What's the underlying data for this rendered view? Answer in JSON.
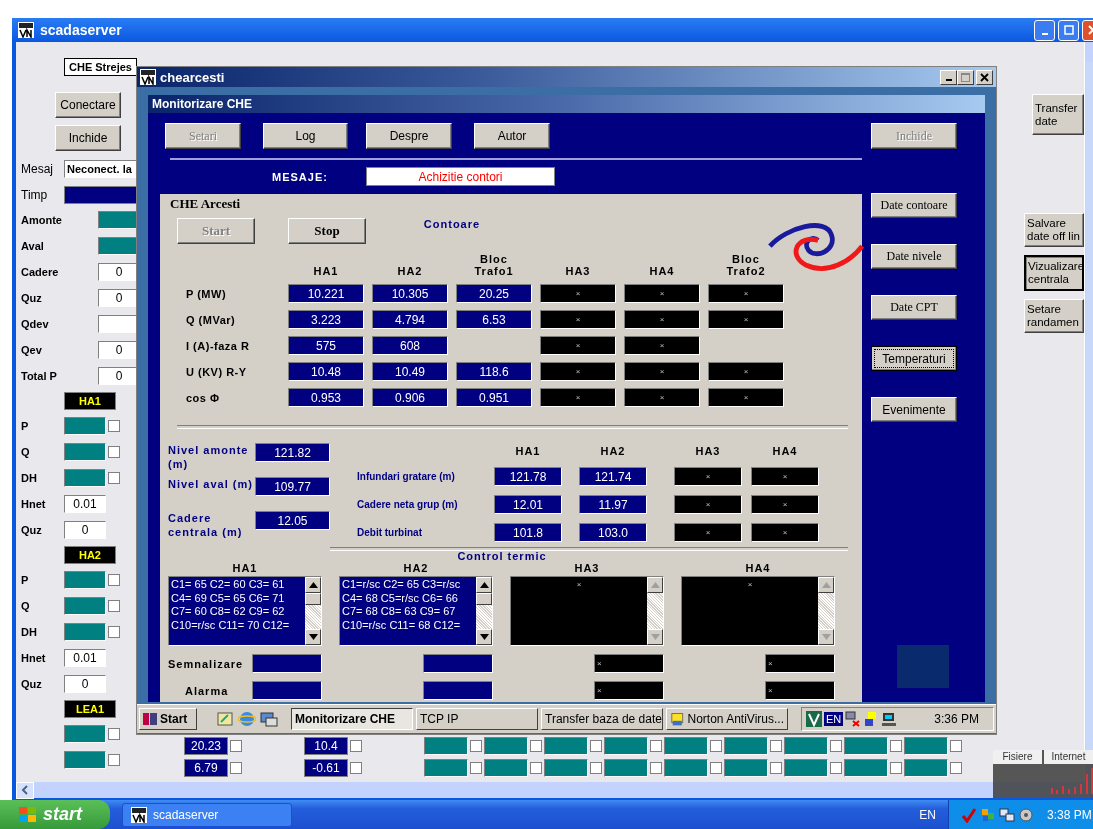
{
  "window": {
    "title": "scadaserver"
  },
  "station_selector": {
    "value": "CHE Strejes"
  },
  "left_panel": {
    "buttons": [
      "Conectare",
      "Inchide"
    ],
    "mesaj": {
      "label": "Mesaj",
      "value": "Neconect. la"
    },
    "timp": {
      "label": "Timp"
    },
    "params": [
      {
        "label": "Amonte",
        "kind": "indicator"
      },
      {
        "label": "Aval",
        "kind": "indicator"
      },
      {
        "label": "Cadere",
        "kind": "field",
        "value": "0"
      },
      {
        "label": "Quz",
        "kind": "field",
        "value": "0"
      },
      {
        "label": "Qdev",
        "kind": "field"
      },
      {
        "label": "Qev",
        "kind": "field",
        "value": "0"
      },
      {
        "label": "Total P",
        "kind": "field",
        "value": "0"
      }
    ],
    "groups": [
      {
        "tag": "HA1",
        "rows": [
          {
            "label": "P",
            "kind": "indicator",
            "checked": false
          },
          {
            "label": "Q",
            "kind": "indicator",
            "checked": false
          },
          {
            "label": "DH",
            "kind": "indicator",
            "checked": false
          },
          {
            "label": "Hnet",
            "kind": "field",
            "value": "0.01"
          },
          {
            "label": "Quz",
            "kind": "field",
            "value": "0"
          }
        ]
      },
      {
        "tag": "HA2",
        "rows": [
          {
            "label": "P",
            "kind": "indicator",
            "checked": false
          },
          {
            "label": "Q",
            "kind": "indicator",
            "checked": false
          },
          {
            "label": "DH",
            "kind": "indicator",
            "checked": false
          },
          {
            "label": "Hnet",
            "kind": "field",
            "value": "0.01"
          },
          {
            "label": "Quz",
            "kind": "field",
            "value": "0"
          }
        ]
      },
      {
        "tag": "LEA1",
        "rows": [
          {
            "kind": "indicator",
            "checked": false
          },
          {
            "kind": "indicator",
            "checked": false
          }
        ]
      }
    ]
  },
  "right_buttons": [
    {
      "label": "Transfer date",
      "pressed": false
    },
    {
      "label": "Salvare date off lin",
      "pressed": false
    },
    {
      "label": "Vizualizare centrala",
      "pressed": true
    },
    {
      "label": "Setare randamen",
      "pressed": false
    }
  ],
  "bottom_rows": [
    {
      "cells": [
        {
          "kind": "value",
          "value": "20.23",
          "checked": false
        },
        {
          "kind": "value",
          "value": "10.4",
          "checked": false
        },
        {
          "kind": "indicator",
          "checked": false
        },
        {
          "kind": "indicator",
          "checked": false
        },
        {
          "kind": "indicator",
          "checked": false
        },
        {
          "kind": "indicator",
          "checked": false
        },
        {
          "kind": "indicator",
          "checked": false
        },
        {
          "kind": "indicator",
          "checked": false
        },
        {
          "kind": "indicator",
          "checked": false
        },
        {
          "kind": "indicator",
          "checked": false
        },
        {
          "kind": "indicator",
          "checked": false
        }
      ]
    },
    {
      "cells": [
        {
          "kind": "value",
          "value": "6.79",
          "checked": false
        },
        {
          "kind": "value",
          "value": "-0.61",
          "checked": false
        },
        {
          "kind": "indicator",
          "checked": false
        },
        {
          "kind": "indicator",
          "checked": false
        },
        {
          "kind": "indicator",
          "checked": false
        },
        {
          "kind": "indicator",
          "checked": false
        },
        {
          "kind": "indicator",
          "checked": false
        },
        {
          "kind": "indicator",
          "checked": false
        },
        {
          "kind": "indicator",
          "checked": false
        },
        {
          "kind": "indicator",
          "checked": false
        },
        {
          "kind": "indicator",
          "checked": false
        }
      ]
    }
  ],
  "dialog": {
    "title": "chearcesti",
    "frame_title": "Monitorizare CHE",
    "toolbar": [
      {
        "label": "Setari",
        "disabled": true
      },
      {
        "label": "Log",
        "disabled": false
      },
      {
        "label": "Despre",
        "disabled": false
      },
      {
        "label": "Autor",
        "disabled": false
      }
    ],
    "close_button": {
      "label": "Inchide",
      "disabled": true
    },
    "messages": {
      "label": "MESAJE:",
      "value": "Achizitie contori"
    },
    "side_buttons": [
      {
        "label": "Date contoare",
        "focused": false
      },
      {
        "label": "Date nivele",
        "focused": false
      },
      {
        "label": "Date CPT",
        "focused": false
      },
      {
        "label": "Temperaturi",
        "focused": true
      },
      {
        "label": "Evenimente",
        "focused": false
      }
    ],
    "group": {
      "title": "CHE Arcesti",
      "buttons": [
        {
          "label": "Start",
          "disabled": true
        },
        {
          "label": "Stop",
          "disabled": false
        }
      ],
      "contoare": {
        "title": "Contoare",
        "columns": [
          {
            "label": "HA1",
            "online": true
          },
          {
            "label": "HA2",
            "online": true
          },
          {
            "label": "Bloc Trafo1",
            "online": true
          },
          {
            "label": "HA3",
            "online": false
          },
          {
            "label": "HA4",
            "online": false
          },
          {
            "label": "Bloc Trafo2",
            "online": false
          }
        ],
        "rows": [
          {
            "label": "P (MW)",
            "cells": [
              "10.221",
              "10.305",
              "20.25",
              "×",
              "×",
              "×"
            ]
          },
          {
            "label": "Q (MVar)",
            "cells": [
              "3.223",
              "4.794",
              "6.53",
              "×",
              "×",
              "×"
            ]
          },
          {
            "label": "I (A)-faza R",
            "cells": [
              "575",
              "608",
              null,
              "×",
              "×",
              null
            ]
          },
          {
            "label": "U (KV) R-Y",
            "cells": [
              "10.48",
              "10.49",
              "118.6",
              "×",
              "×",
              "×"
            ]
          },
          {
            "label": "cos Φ",
            "cells": [
              "0.953",
              "0.906",
              "0.951",
              "×",
              "×",
              "×"
            ]
          }
        ]
      },
      "levels": [
        {
          "label": "Nivel amonte (m)",
          "value": "121.82"
        },
        {
          "label": "Nivel aval (m)",
          "value": "109.77"
        },
        {
          "label": "Cadere centrala (m)",
          "value": "12.05"
        }
      ],
      "units": {
        "columns": [
          {
            "label": "HA1",
            "online": true
          },
          {
            "label": "HA2",
            "online": true
          },
          {
            "label": "HA3",
            "online": false
          },
          {
            "label": "HA4",
            "online": false
          }
        ],
        "rows": [
          {
            "label": "Infundari gratare (m)",
            "cells": [
              "121.78",
              "121.74",
              "×",
              "×"
            ]
          },
          {
            "label": "Cadere neta grup (m)",
            "cells": [
              "12.01",
              "11.97",
              "×",
              "×"
            ]
          },
          {
            "label": "Debit turbinat",
            "cells": [
              "101.8",
              "103.0",
              "×",
              "×"
            ]
          }
        ]
      },
      "thermal": {
        "title": "Control termic",
        "units": [
          {
            "label": "HA1",
            "online": true,
            "lines": [
              "C1= 65  C2= 60  C3= 61",
              "C4= 69  C5= 65  C6= 71",
              "C7= 60  C8= 62  C9= 62",
              "C10=r/sc  C11= 70  C12="
            ]
          },
          {
            "label": "HA2",
            "online": true,
            "lines": [
              "C1=r/sc  C2= 65  C3=r/sc",
              "C4= 68  C5=r/sc  C6= 66",
              "C7= 68  C8= 63  C9= 67",
              "C10=r/sc  C11= 68  C12="
            ]
          },
          {
            "label": "HA3",
            "online": false,
            "lines": [
              "×"
            ]
          },
          {
            "label": "HA4",
            "online": false,
            "lines": [
              "×"
            ]
          }
        ]
      },
      "alarms": [
        {
          "label": "Semnalizare",
          "cells": [
            null,
            null,
            "×",
            "×"
          ]
        },
        {
          "label": "Alarma",
          "cells": [
            null,
            null,
            "×",
            "×"
          ]
        }
      ]
    }
  },
  "dialog_taskbar": {
    "start": "Start",
    "tasks": [
      {
        "label": "Monitorizare CHE",
        "selected": true
      },
      {
        "label": "TCP IP",
        "selected": false
      },
      {
        "label": "Transfer baza de date",
        "selected": false
      },
      {
        "label": "Norton AntiVirus...",
        "selected": false
      }
    ],
    "language": "EN",
    "time": "3:36 PM"
  },
  "graph_widget": {
    "tabs": [
      "Fisiere",
      "Internet"
    ]
  },
  "taskbar": {
    "start": "start",
    "tasks": [
      {
        "label": "scadaserver",
        "selected": false
      }
    ],
    "language": "EN",
    "time": "3:38 PM"
  }
}
